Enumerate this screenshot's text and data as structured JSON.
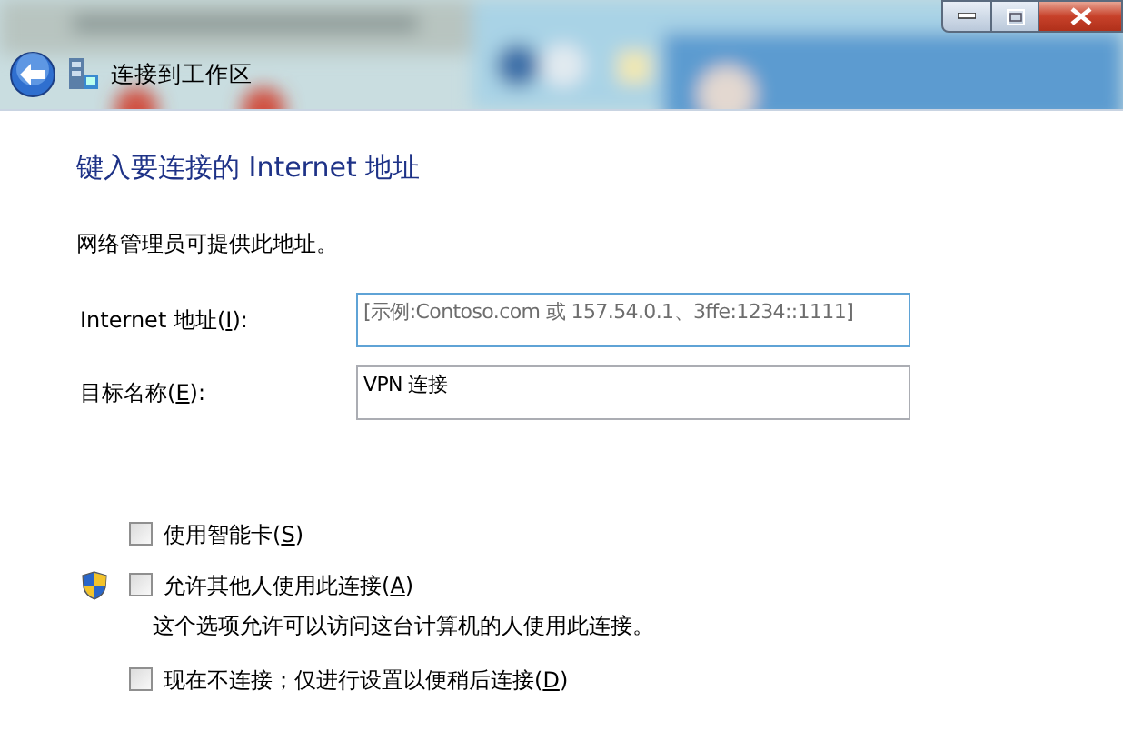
{
  "window": {
    "title": "连接到工作区"
  },
  "heading": "键入要连接的 Internet 地址",
  "note": "网络管理员可提供此地址。",
  "fields": [
    {
      "label": {
        "before": "Internet 地址(",
        "key": "I",
        "after": "):"
      },
      "placeholder": "[示例:Contoso.com 或 157.54.0.1、3ffe:1234::1111]",
      "focused": true
    },
    {
      "label": {
        "before": "目标名称(",
        "key": "E",
        "after": "):"
      },
      "value": "VPN 连接",
      "focused": false
    }
  ],
  "options": [
    {
      "label": {
        "before": "使用智能卡(",
        "key": "S",
        "after": ")"
      },
      "checked": false,
      "shield": false
    },
    {
      "label": {
        "before": "允许其他人使用此连接(",
        "key": "A",
        "after": ")"
      },
      "checked": false,
      "shield": true,
      "description": "这个选项允许可以访问这台计算机的人使用此连接。"
    },
    {
      "label": {
        "before": "现在不连接；仅进行设置以便稍后连接(",
        "key": "D",
        "after": ")"
      },
      "checked": false,
      "shield": false
    }
  ]
}
